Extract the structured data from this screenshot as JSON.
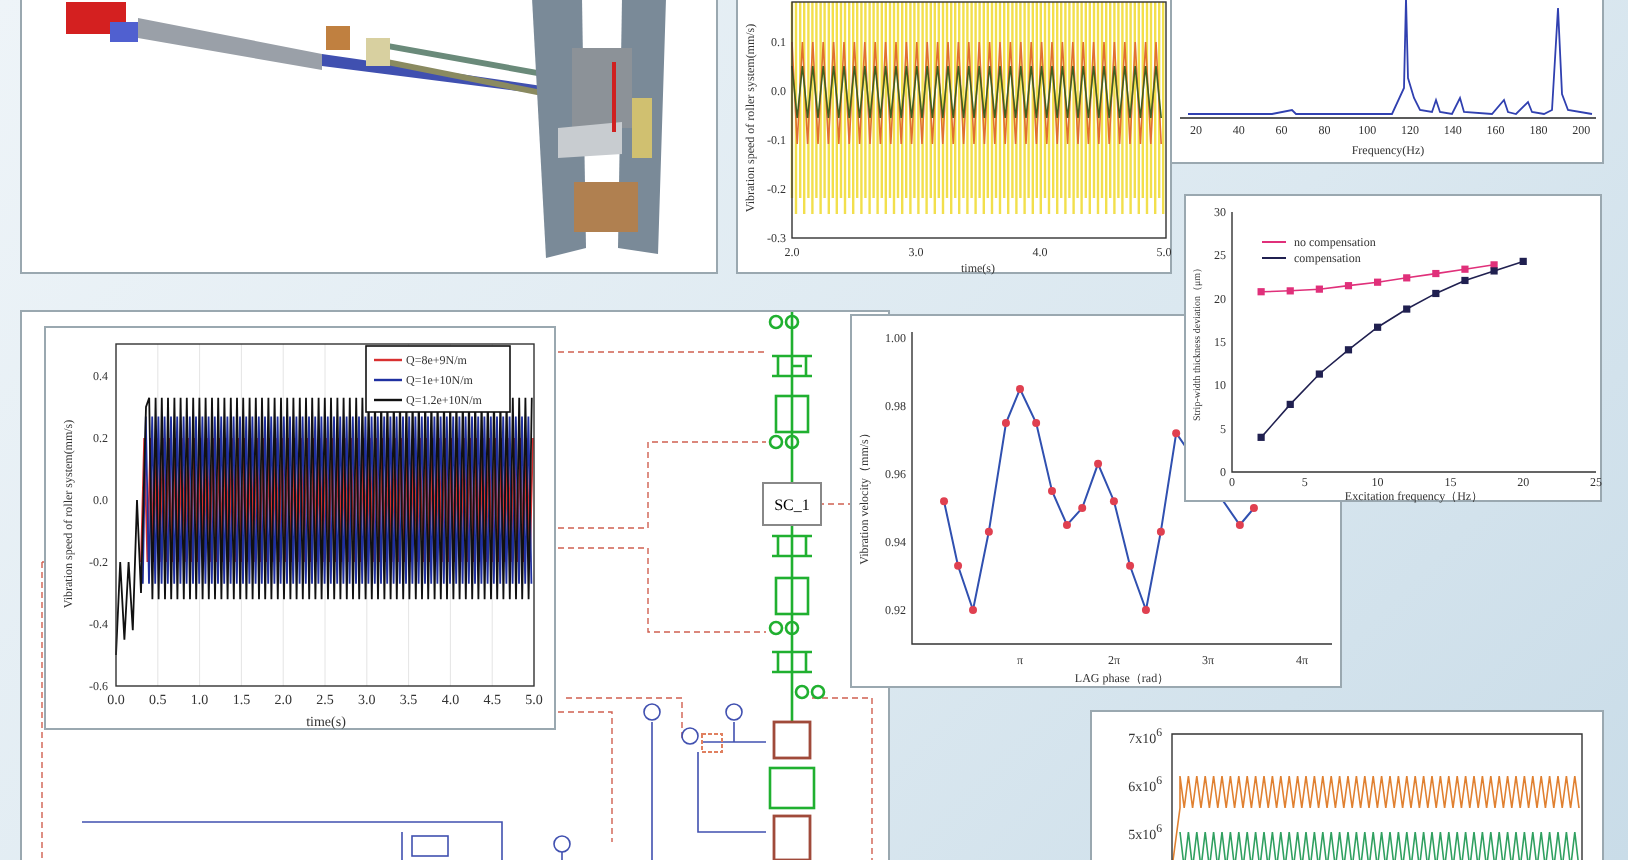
{
  "speed_plot_top": {
    "ylabel": "Vibration speed of roller system(mm/s)",
    "yticks": [
      "0.1",
      "0.0",
      "-0.1",
      "-0.2",
      "-0.3"
    ],
    "xticks": [
      "2.0",
      "3.0",
      "4.0",
      "5.0"
    ],
    "xlabel": "time(s)"
  },
  "spectrum": {
    "xticks": [
      "20",
      "40",
      "60",
      "80",
      "100",
      "120",
      "140",
      "160",
      "180",
      "200"
    ],
    "xlabel": "Frequency(Hz)"
  },
  "schematic": {
    "block_label": "SC_1"
  },
  "speed_plot_main": {
    "ylabel": "Vibration speed of roller system(mm/s)",
    "yticks": [
      "0.4",
      "0.2",
      "0.0",
      "-0.2",
      "-0.4",
      "-0.6"
    ],
    "xticks": [
      "0.0",
      "0.5",
      "1.0",
      "1.5",
      "2.0",
      "2.5",
      "3.0",
      "3.5",
      "4.0",
      "4.5",
      "5.0"
    ],
    "xlabel": "time(s)",
    "legend": [
      {
        "label": "Q=8e+9N/m",
        "color": "#d83030"
      },
      {
        "label": "Q=1e+10N/m",
        "color": "#2030a0"
      },
      {
        "label": "Q=1.2e+10N/m",
        "color": "#111111"
      }
    ]
  },
  "lag_chart": {
    "chart_data": {
      "type": "line",
      "xlabel": "LAG phase（rad）",
      "ylabel": "Vibration velocity（mm/s）",
      "x": [
        0.6,
        1.07,
        1.57,
        2.1,
        2.67,
        3.14,
        3.68,
        4.21,
        4.71,
        5.22,
        5.75,
        6.28,
        6.82,
        7.35,
        7.85,
        8.36,
        10.49,
        10.96
      ],
      "xlim": [
        -0.47,
        13.57
      ],
      "ylim": [
        0.91,
        1.0
      ],
      "xticks": [
        {
          "value": 3.1416,
          "label": "π"
        },
        {
          "value": 6.2832,
          "label": "2π"
        },
        {
          "value": 9.4248,
          "label": "3π"
        },
        {
          "value": 12.5664,
          "label": "4π"
        }
      ],
      "yticks": [
        0.92,
        0.94,
        0.96,
        0.98,
        {
          "value": 1.0,
          "label": "1.00"
        }
      ],
      "series": [
        {
          "color": "#3050b0",
          "marker": "circle",
          "values": [
            0.952,
            0.933,
            0.92,
            0.943,
            0.975,
            0.985,
            0.975,
            0.955,
            0.945,
            0.95,
            0.963,
            0.952,
            0.933,
            0.92,
            0.943,
            0.972,
            0.945,
            0.95
          ]
        }
      ]
    }
  },
  "thickness_chart": {
    "chart_data": {
      "type": "line",
      "xlabel": "Excitation frequency（Hz）",
      "ylabel": "Strip-width thickness deviation（μm）",
      "x": [
        2,
        4,
        6,
        8,
        10,
        12,
        14,
        16,
        18,
        20
      ],
      "xlim": [
        0,
        25
      ],
      "ylim": [
        0,
        30
      ],
      "xticks": [
        0,
        5,
        10,
        15,
        20,
        25
      ],
      "yticks": [
        0,
        5,
        10,
        15,
        20,
        25,
        30
      ],
      "legend": "upper left",
      "series": [
        {
          "name": "no compensation",
          "color": "#e0307a",
          "marker": "square",
          "values": [
            20.8,
            20.9,
            21.1,
            21.5,
            21.9,
            22.4,
            22.9,
            23.4,
            23.9,
            null
          ]
        },
        {
          "name": "compensation",
          "color": "#202050",
          "marker": "square",
          "values": [
            4,
            7.8,
            11.3,
            14.1,
            16.7,
            18.8,
            20.6,
            22.1,
            23.2,
            24.3
          ]
        }
      ]
    }
  },
  "force_plot": {
    "yticks": [
      "7x10$^{6}$",
      "6x10$^{6}$",
      "5x10$^{6}$"
    ]
  }
}
